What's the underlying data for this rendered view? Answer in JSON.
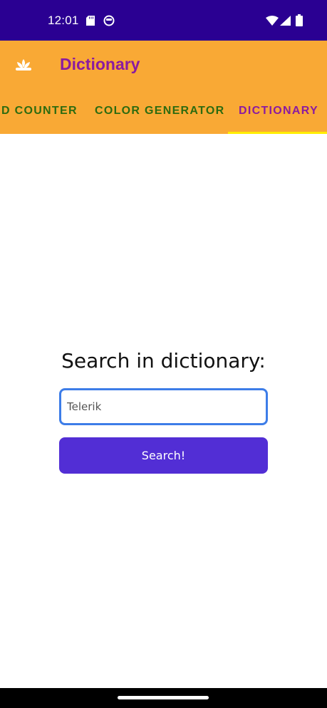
{
  "status_bar": {
    "time": "12:01",
    "icons": [
      "sd-card-icon",
      "face-icon",
      "wifi-icon",
      "signal-icon",
      "battery-icon"
    ]
  },
  "app_bar": {
    "title": "Dictionary",
    "logo_icon": "lotus-icon",
    "background_color": "#f9a935",
    "title_color": "#8b1ba0"
  },
  "tabs": [
    {
      "label": "D COUNTER",
      "active": false
    },
    {
      "label": "COLOR GENERATOR",
      "active": false
    },
    {
      "label": "DICTIONARY",
      "active": true
    }
  ],
  "tab_colors": {
    "inactive": "#2d6b10",
    "active": "#8b1ba0",
    "indicator": "#ffee00"
  },
  "main": {
    "heading": "Search in dictionary:",
    "search_value": "Telerik",
    "search_button_label": "Search!",
    "button_color": "#522ed5",
    "input_border_color": "#3d7de8"
  },
  "theme": {
    "status_bar_color": "#2a0092"
  }
}
